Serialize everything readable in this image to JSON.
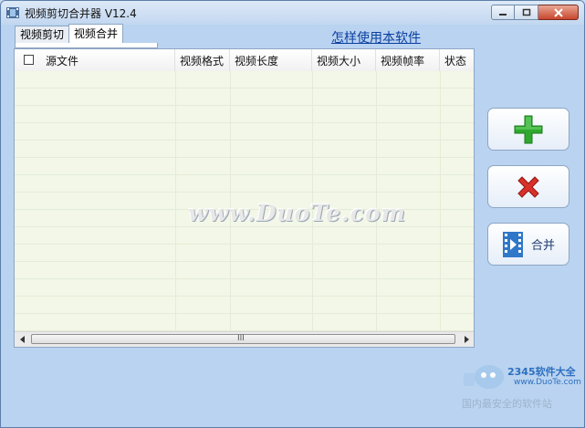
{
  "window": {
    "title": "视频剪切合并器 V12.4"
  },
  "tabs": [
    {
      "label": "视频剪切",
      "active": false
    },
    {
      "label": "视频合并",
      "active": true
    }
  ],
  "help_link": "怎样使用本软件",
  "table": {
    "columns": [
      "源文件",
      "视频格式",
      "视频长度",
      "视频大小",
      "视频帧率",
      "状态"
    ],
    "rows": []
  },
  "buttons": {
    "add_icon": "plus-icon",
    "remove_icon": "delete-icon",
    "merge_label": "合并",
    "merge_icon": "film-play-icon"
  },
  "scrollbar": {
    "grip": "III"
  },
  "watermark": {
    "text": "www.DuoTe.com",
    "brand": "2345软件大全",
    "url": "www.DuoTe.com",
    "slogan": "国内最安全的软件站"
  },
  "colors": {
    "add": "#2fa82f",
    "remove": "#d8302a",
    "link": "#0b3fa0"
  }
}
